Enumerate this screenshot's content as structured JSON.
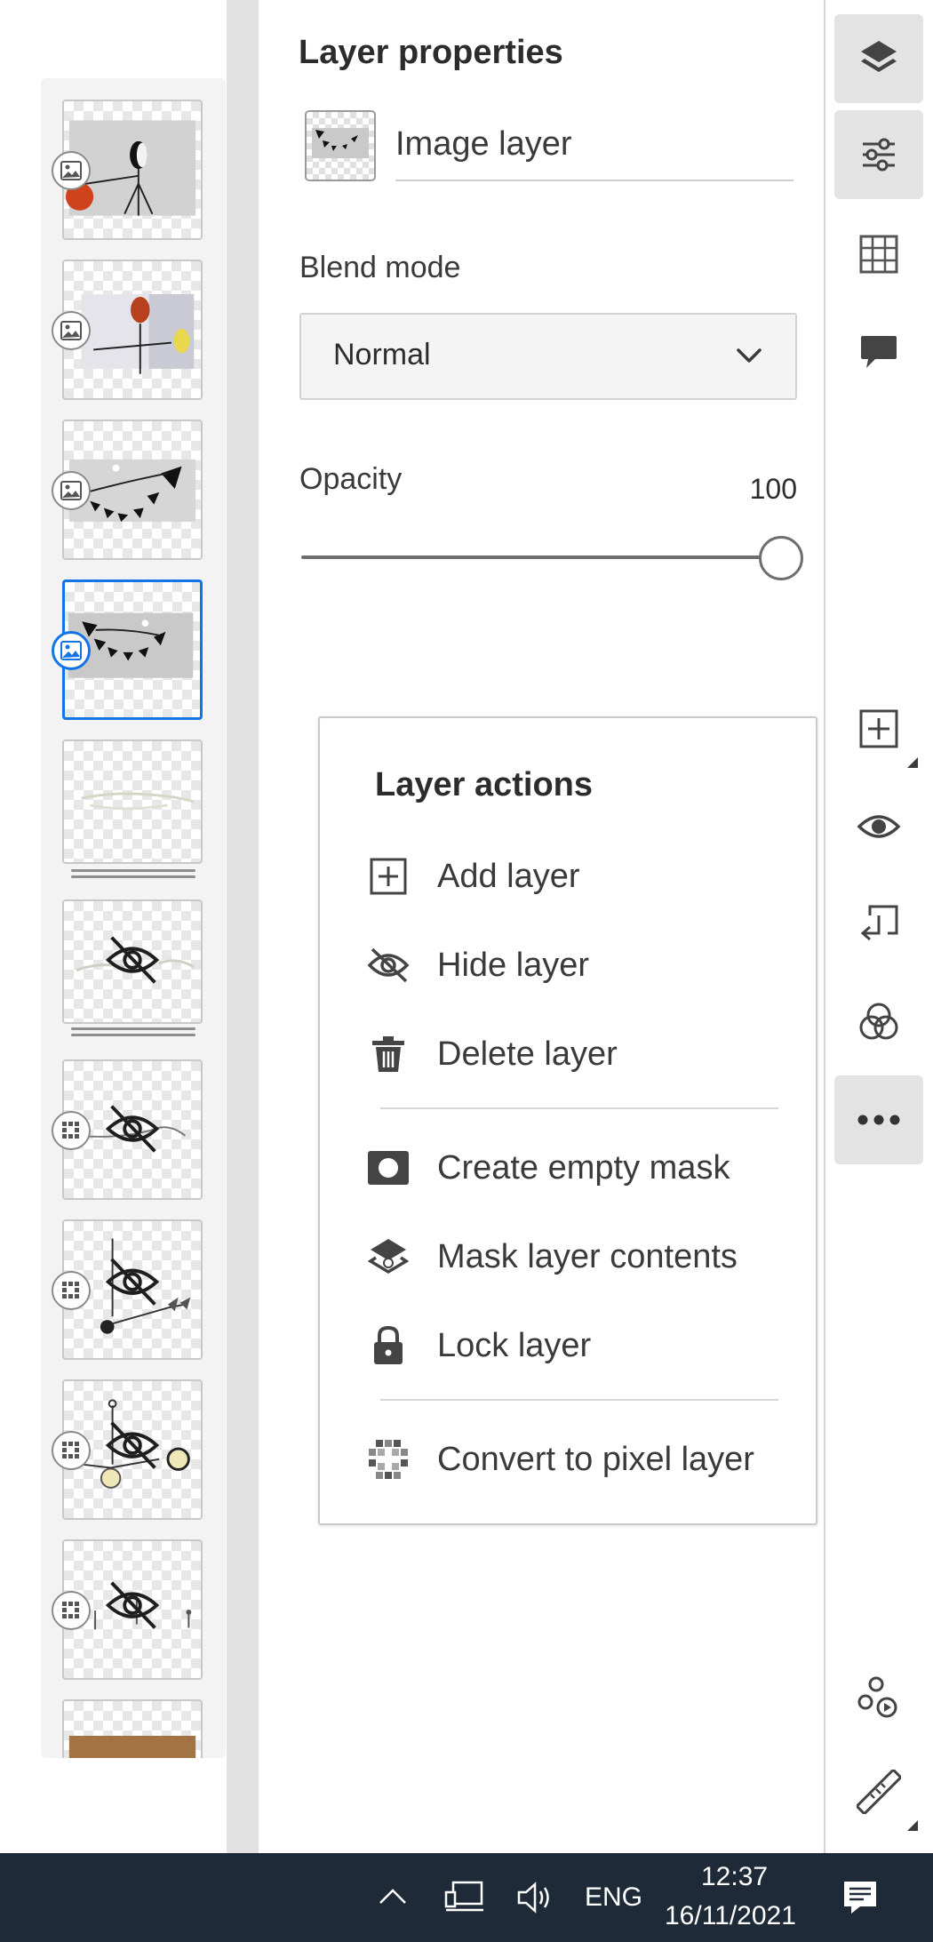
{
  "properties": {
    "title": "Layer properties",
    "layer_name": "Image layer",
    "blend_mode_label": "Blend mode",
    "blend_mode_value": "Normal",
    "opacity_label": "Opacity",
    "opacity_value": "100",
    "opacity_fraction": 1.0
  },
  "layer_actions": {
    "title": "Layer actions",
    "items": [
      {
        "label": "Add layer",
        "icon": "add-square-icon"
      },
      {
        "label": "Hide layer",
        "icon": "eye-slash-icon"
      },
      {
        "label": "Delete layer",
        "icon": "trash-icon"
      },
      {
        "label": "Create empty mask",
        "icon": "mask-icon"
      },
      {
        "label": "Mask layer contents",
        "icon": "mask-contents-icon"
      },
      {
        "label": "Lock layer",
        "icon": "lock-icon"
      },
      {
        "label": "Convert to pixel layer",
        "icon": "pixel-grid-icon"
      }
    ]
  },
  "layers": [
    {
      "type": "image",
      "hidden": false,
      "selected": false
    },
    {
      "type": "image",
      "hidden": false,
      "selected": false
    },
    {
      "type": "image",
      "hidden": false,
      "selected": false
    },
    {
      "type": "image",
      "hidden": false,
      "selected": true
    },
    {
      "type": "group",
      "hidden": false,
      "selected": false
    },
    {
      "type": "group",
      "hidden": true,
      "selected": false
    },
    {
      "type": "pixel",
      "hidden": true,
      "selected": false
    },
    {
      "type": "pixel",
      "hidden": true,
      "selected": false
    },
    {
      "type": "pixel",
      "hidden": true,
      "selected": false
    },
    {
      "type": "pixel",
      "hidden": true,
      "selected": false
    },
    {
      "type": "image",
      "hidden": false,
      "selected": false
    }
  ],
  "toolbar": {
    "tools": [
      "layers-icon",
      "adjustments-icon",
      "grid-icon",
      "comment-icon",
      "add-layer-icon",
      "visibility-icon",
      "import-icon",
      "blend-icon",
      "more-icon",
      "share-icon",
      "ruler-icon"
    ],
    "active": [
      "layers-icon",
      "adjustments-icon",
      "more-icon"
    ]
  },
  "taskbar": {
    "language": "ENG",
    "time": "12:37",
    "date": "16/11/2021"
  },
  "colors": {
    "accent": "#1473e6",
    "taskbar": "#1f2a38",
    "selection_tint": "#e3e3e3"
  }
}
